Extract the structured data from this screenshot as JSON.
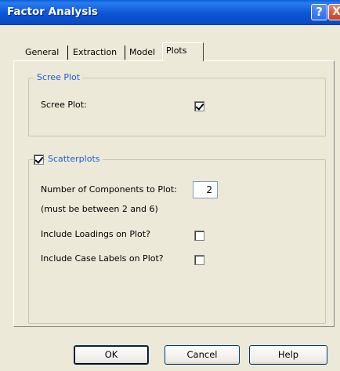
{
  "window": {
    "title": "Factor Analysis",
    "help_glyph": "?",
    "close_glyph": "X"
  },
  "tabs": [
    {
      "label": "General"
    },
    {
      "label": "Extraction"
    },
    {
      "label": "Model"
    },
    {
      "label": "Plots",
      "active": true
    }
  ],
  "scree_group": {
    "legend": "Scree Plot",
    "checkbox_label": "Scree Plot:",
    "checked": true
  },
  "scatter_group": {
    "legend": "Scatterplots",
    "enabled": true,
    "num_components_label": "Number of Components to Plot:",
    "num_components_value": "2",
    "hint": "(must be between 2 and 6)",
    "loadings_label": "Include Loadings on Plot?",
    "loadings_checked": false,
    "case_labels_label": "Include Case Labels on Plot?",
    "case_labels_checked": false
  },
  "buttons": {
    "ok": "OK",
    "cancel": "Cancel",
    "help": "Help"
  },
  "colors": {
    "titlebar": "#0b55d6",
    "group_legend": "#1c5ed4",
    "dialog_bg": "#ece9d8"
  },
  "icons": {
    "help": "question-mark-icon",
    "close": "close-x-icon"
  }
}
